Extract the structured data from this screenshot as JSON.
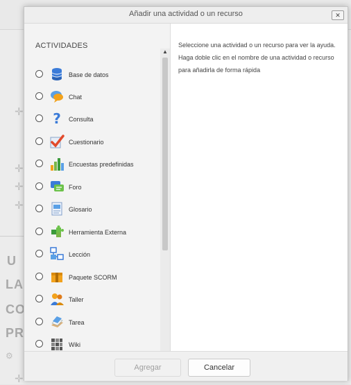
{
  "dialog": {
    "title": "Añadir una actividad o un recurso",
    "close_label": "✕",
    "section_label": "ACTIVIDADES",
    "help_text": "Seleccione una actividad o un recurso para ver la ayuda. Haga doble clic en el nombre de una actividad o recurso para añadirla de forma rápida",
    "activities": [
      {
        "label": "Base de datos",
        "icon": "database-icon"
      },
      {
        "label": "Chat",
        "icon": "chat-icon"
      },
      {
        "label": "Consulta",
        "icon": "question-icon"
      },
      {
        "label": "Cuestionario",
        "icon": "checkmark-icon"
      },
      {
        "label": "Encuestas predefinidas",
        "icon": "bar-chart-icon"
      },
      {
        "label": "Foro",
        "icon": "forum-icon"
      },
      {
        "label": "Glosario",
        "icon": "glossary-icon"
      },
      {
        "label": "Herramienta Externa",
        "icon": "puzzle-icon"
      },
      {
        "label": "Lección",
        "icon": "lesson-icon"
      },
      {
        "label": "Paquete SCORM",
        "icon": "package-icon"
      },
      {
        "label": "Taller",
        "icon": "workshop-icon"
      },
      {
        "label": "Tarea",
        "icon": "assignment-icon"
      },
      {
        "label": "Wiki",
        "icon": "wiki-icon"
      }
    ],
    "buttons": {
      "add": "Agregar",
      "cancel": "Cancelar"
    },
    "scroll_up": "▲",
    "scroll_down": "▼"
  },
  "background": {
    "plus_glyph": "✛",
    "letters": [
      "U",
      "LA",
      "CO",
      "PR"
    ],
    "gear_glyph": "⚙"
  }
}
